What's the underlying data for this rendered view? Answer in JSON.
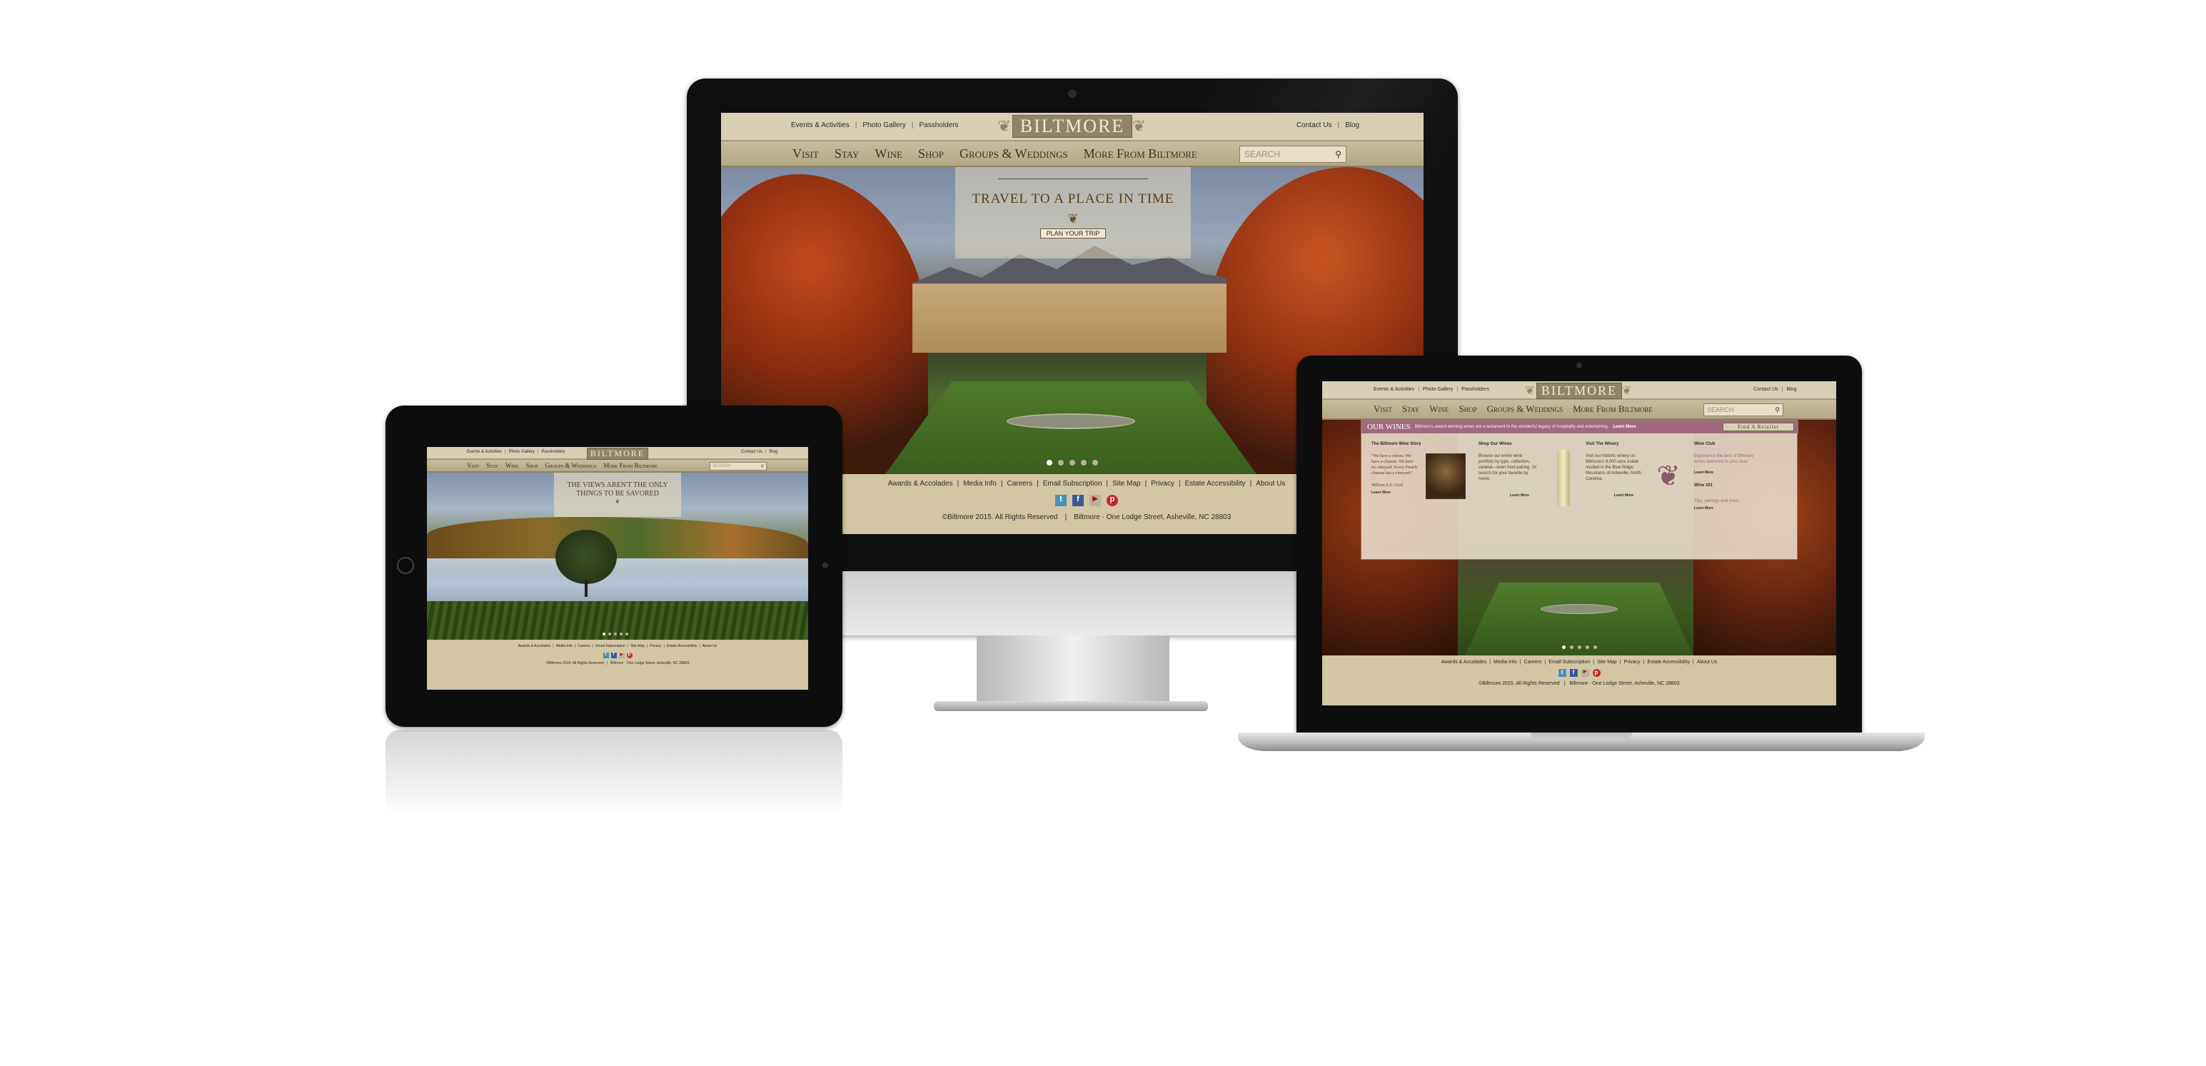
{
  "brand": {
    "logo": "BILTMORE"
  },
  "utility_left": [
    "Events & Activities",
    "Photo Gallery",
    "Passholders"
  ],
  "utility_right": [
    "Contact Us",
    "Blog"
  ],
  "nav": [
    "Visit",
    "Stay",
    "Wine",
    "Shop",
    "Groups & Weddings",
    "More From Biltmore"
  ],
  "search_placeholder": "SEARCH",
  "desktop": {
    "hero_title": "TRAVEL TO A PLACE IN TIME",
    "hero_button": "PLAN YOUR TRIP"
  },
  "tablet": {
    "hero_title": "THE VIEWS AREN'T THE ONLY THINGS TO BE SAVORED"
  },
  "laptop": {
    "banner_title": "OUR WINES",
    "banner_text": "Biltmore's award-winning wines are a testament to the wonderful legacy of hospitality and entertaining.",
    "banner_link": "Learn More",
    "banner_button": "Find A Retailer",
    "columns": [
      {
        "title": "The Biltmore Wine Story",
        "text": "\"We have a cheese. We have a chateau. We have no vineyard. Every French chateau has a vineyard.\"",
        "author": "William A.V. Cecil",
        "link": "Learn More"
      },
      {
        "title": "Shop Our Wines",
        "text": "Browse our entire wine portfolio by type, collection, varietal—even food pairing. Or search for your favorite by name.",
        "link": "Learn More"
      },
      {
        "title": "Visit The Winery",
        "text": "Visit our historic winery on Biltmore's 8,000-acre estate nestled in the Blue Ridge Mountains of Asheville, North Carolina.",
        "link": "Learn More"
      },
      {
        "title": "Wine Club",
        "text": "Experience the best of Biltmore wines delivered to your door.",
        "link": "Learn More",
        "extra1": "Wine 101",
        "extra2": "Tips, pairings and more",
        "extra_link": "Learn More"
      }
    ]
  },
  "footer": {
    "links": [
      "Awards & Accolades",
      "Media Info",
      "Careers",
      "Email Subscription",
      "Site Map",
      "Privacy",
      "Estate Accessibility",
      "About Us"
    ],
    "copyright": "©Biltmore 2015. All Rights Reserved",
    "address": "Biltmore · One Lodge Street, Asheville, NC 28803"
  },
  "social_icons": [
    "twitter-icon",
    "facebook-icon",
    "youtube-icon",
    "pinterest-icon"
  ],
  "colors": {
    "header_beige": "#d8cfb4",
    "nav_beige": "#b3a886",
    "footer_beige": "#d2c6a3",
    "logo_gold": "#8f8566",
    "device_black": "#111111"
  }
}
